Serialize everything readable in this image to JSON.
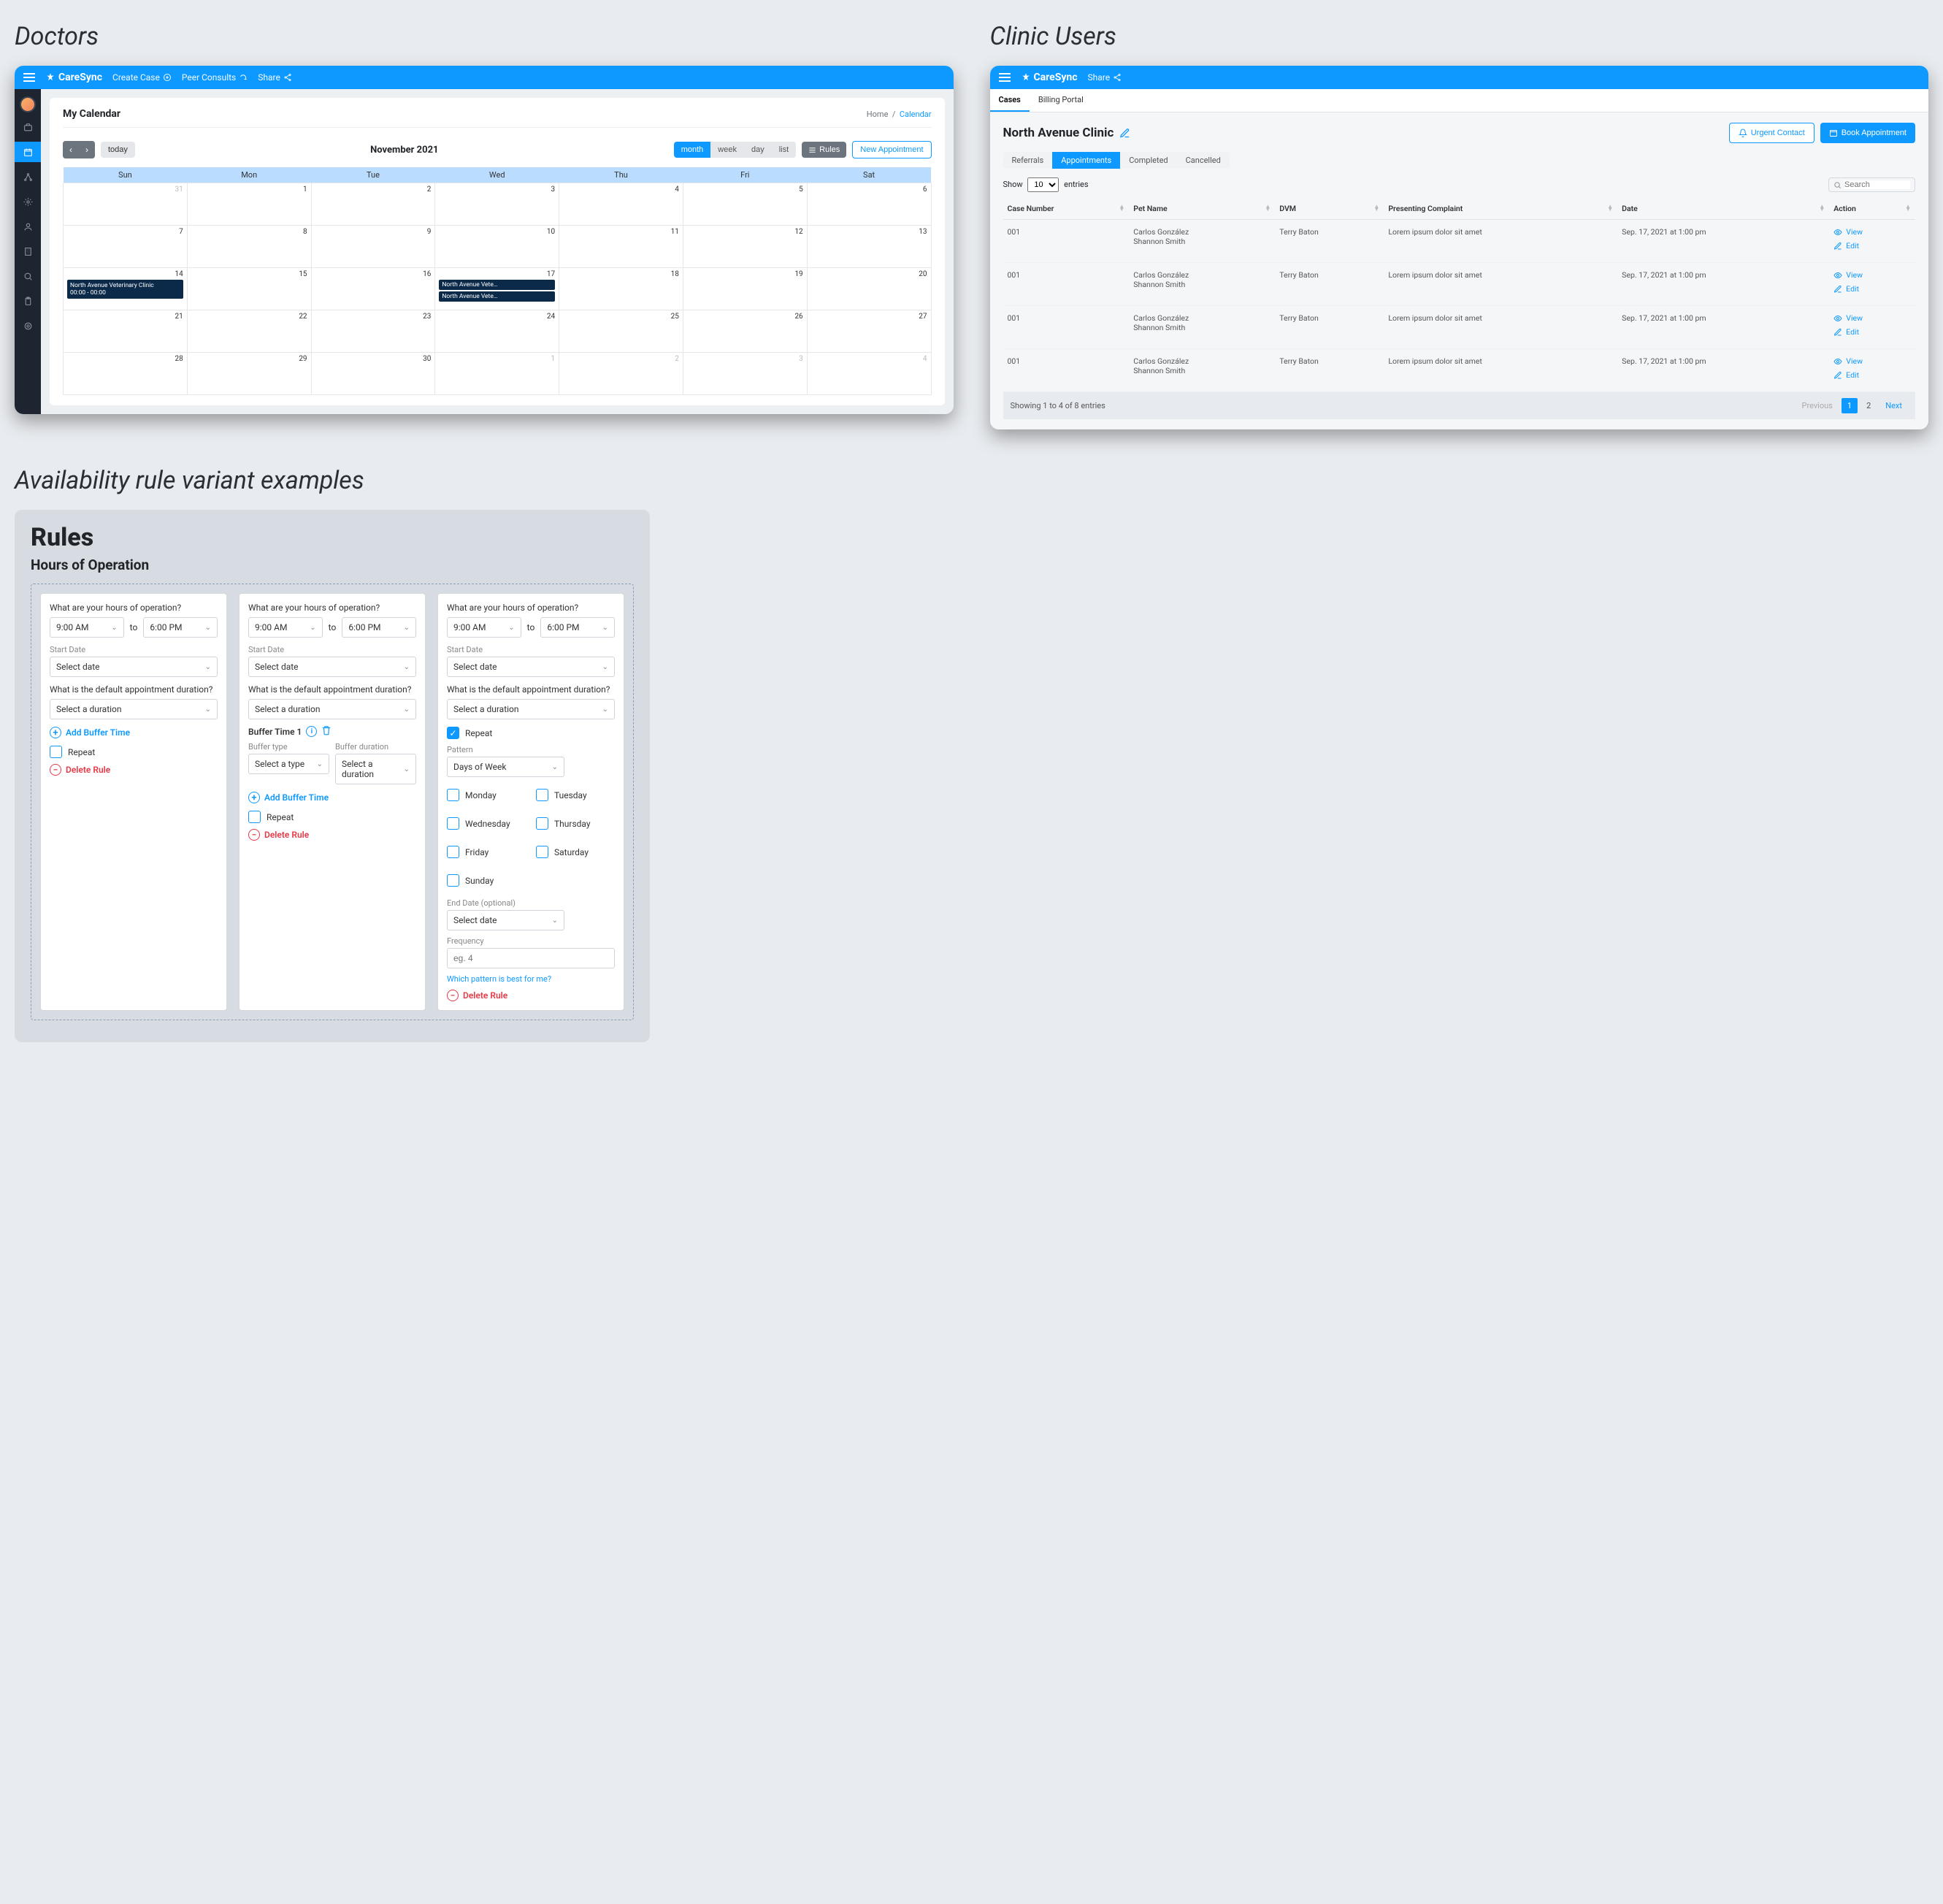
{
  "section_doctors": "Doctors",
  "section_clinic": "Clinic Users",
  "section_rules": "Availability rule variant examples",
  "brand": "CareSync",
  "topbar": {
    "create_case": "Create Case",
    "peer": "Peer Consults",
    "share": "Share"
  },
  "doctor": {
    "title": "My Calendar",
    "crumb_home": "Home",
    "crumb_current": "Calendar",
    "today": "today",
    "month_title": "November 2021",
    "views": {
      "month": "month",
      "week": "week",
      "day": "day",
      "list": "list"
    },
    "rules_btn": "Rules",
    "new_appt": "New Appointment",
    "days": [
      "Sun",
      "Mon",
      "Tue",
      "Wed",
      "Thu",
      "Fri",
      "Sat"
    ],
    "event_full": {
      "name": "North Avenue Veterinary Clinic",
      "time": "00:00 - 00:00"
    },
    "event_short": "North Avenue Vete…"
  },
  "clinic": {
    "tabs": {
      "cases": "Cases",
      "billing": "Billing Portal"
    },
    "name": "North Avenue Clinic",
    "urgent": "Urgent Contact",
    "book": "Book Appointment",
    "subtabs": {
      "referrals": "Referrals",
      "appointments": "Appointments",
      "completed": "Completed",
      "cancelled": "Cancelled"
    },
    "show": "Show",
    "entries": "entries",
    "page_size": "10",
    "search_ph": "Search",
    "cols": {
      "case": "Case Number",
      "pet": "Pet Name",
      "dvm": "DVM",
      "complaint": "Presenting Complaint",
      "date": "Date",
      "action": "Action"
    },
    "rows": [
      {
        "case": "001",
        "pet1": "Carlos González",
        "pet2": "Shannon Smith",
        "dvm": "Terry Baton",
        "complaint": "Lorem ipsum dolor sit amet",
        "date": "Sep. 17, 2021 at 1:00 pm"
      },
      {
        "case": "001",
        "pet1": "Carlos González",
        "pet2": "Shannon Smith",
        "dvm": "Terry Baton",
        "complaint": "Lorem ipsum dolor sit amet",
        "date": "Sep. 17, 2021 at 1:00 pm"
      },
      {
        "case": "001",
        "pet1": "Carlos González",
        "pet2": "Shannon Smith",
        "dvm": "Terry Baton",
        "complaint": "Lorem ipsum dolor sit amet",
        "date": "Sep. 17, 2021 at 1:00 pm"
      },
      {
        "case": "001",
        "pet1": "Carlos González",
        "pet2": "Shannon Smith",
        "dvm": "Terry Baton",
        "complaint": "Lorem ipsum dolor sit amet",
        "date": "Sep. 17, 2021 at 1:00 pm"
      }
    ],
    "view": "View",
    "edit": "Edit",
    "showing": "Showing 1 to 4 of 8 entries",
    "prev": "Previous",
    "next": "Next",
    "p1": "1",
    "p2": "2"
  },
  "rules": {
    "h1": "Rules",
    "h2": "Hours of Operation",
    "q_hours": "What are your hours of operation?",
    "t_from": "9:00 AM",
    "to": "to",
    "t_to": "6:00 PM",
    "start_date": "Start Date",
    "select_date": "Select date",
    "q_duration": "What is the default appointment duration?",
    "select_duration": "Select a duration",
    "add_buffer": "Add Buffer Time",
    "repeat": "Repeat",
    "delete": "Delete Rule",
    "buffer_title": "Buffer Time 1",
    "buffer_type_lbl": "Buffer type",
    "buffer_type_ph": "Select a type",
    "buffer_dur_lbl": "Buffer duration",
    "buffer_dur_ph": "Select a duration",
    "pattern": "Pattern",
    "pattern_val": "Days of Week",
    "days": {
      "mon": "Monday",
      "tue": "Tuesday",
      "wed": "Wednesday",
      "thu": "Thursday",
      "fri": "Friday",
      "sat": "Saturday",
      "sun": "Sunday"
    },
    "end_date": "End Date (optional)",
    "frequency": "Frequency",
    "freq_ph": "eg. 4",
    "help": "Which pattern is best for me?"
  }
}
